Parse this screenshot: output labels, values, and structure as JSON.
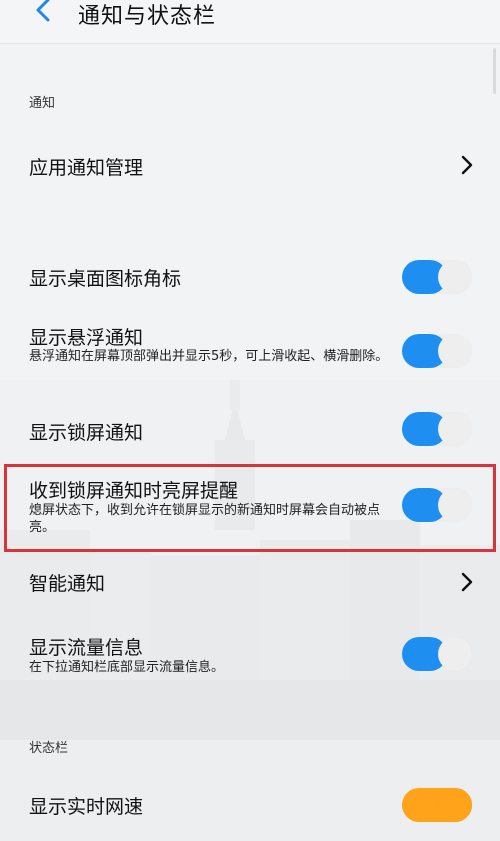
{
  "header": {
    "title": "通知与状态栏"
  },
  "sections": {
    "notifications": "通知",
    "status_bar": "状态栏"
  },
  "rows": {
    "app_notify": {
      "title": "应用通知管理"
    },
    "badge": {
      "title": "显示桌面图标角标",
      "on": true
    },
    "float": {
      "title": "显示悬浮通知",
      "desc": "悬浮通知在屏幕顶部弹出并显示5秒，可上滑收起、横滑删除。",
      "on": true
    },
    "lock": {
      "title": "显示锁屏通知",
      "on": true
    },
    "wake": {
      "title": "收到锁屏通知时亮屏提醒",
      "desc": "熄屏状态下，收到允许在锁屏显示的新通知时屏幕会自动被点亮。",
      "on": true
    },
    "smart": {
      "title": "智能通知"
    },
    "traffic": {
      "title": "显示流量信息",
      "desc": "在下拉通知栏底部显示流量信息。",
      "on": true
    },
    "speed": {
      "title": "显示实时网速",
      "on": true
    }
  },
  "colors": {
    "toggle_on": "#1e8ff0",
    "toggle_on_orange": "#ffa31a",
    "highlight": "#d9343a",
    "back_arrow": "#1f86ee"
  }
}
